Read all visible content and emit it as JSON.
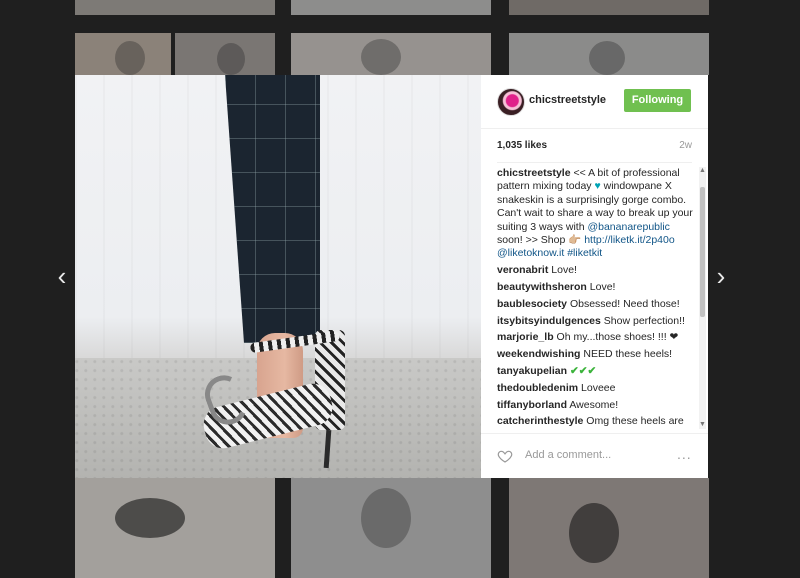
{
  "post": {
    "username": "chicstreetstyle",
    "follow_label": "Following",
    "likes": "1,035 likes",
    "age": "2w",
    "caption": {
      "user": "chicstreetstyle",
      "text1": " << A bit of professional pattern mixing today ",
      "text2": " windowpane X snakeskin is a surprisingly gorge combo. Can't wait to share a way to break up your suiting 3 ways with ",
      "mention1": "@bananarepublic",
      "text3": " soon! >> Shop 👉🏼 ",
      "link1": "http://liketk.it/2p40o",
      "text4": " ",
      "mention2": "@liketoknow.it",
      "text5": " ",
      "hashtag": "#liketkit"
    },
    "comments": [
      {
        "user": "veronabrit",
        "text": "Love!"
      },
      {
        "user": "beautywithsheron",
        "text": "Love!"
      },
      {
        "user": "baublesociety",
        "text": "Obsessed! Need those!"
      },
      {
        "user": "itsybitsyindulgences",
        "text": "Show perfection!!"
      },
      {
        "user": "marjorie_lb",
        "text": "Oh my...those shoes! !!! ❤"
      },
      {
        "user": "weekendwishing",
        "text": "NEED these heels!"
      },
      {
        "user": "tanyakupelian",
        "text": "✔✔✔"
      },
      {
        "user": "thedoubledenim",
        "text": "Loveee"
      },
      {
        "user": "tiffanyborland",
        "text": "Awesome!"
      },
      {
        "user": "catcherinthestyle",
        "text": "Omg these heels are"
      }
    ],
    "comment_placeholder": "Add a comment...",
    "more_label": "...",
    "nav_prev": "‹",
    "nav_next": "›"
  },
  "colors": {
    "follow_button": "#70c050",
    "link": "#125688",
    "backdrop": "#1f1f1f"
  },
  "icons": {
    "heart": "heart-icon",
    "more": "more-options-icon",
    "prev": "chevron-left-icon",
    "next": "chevron-right-icon"
  }
}
